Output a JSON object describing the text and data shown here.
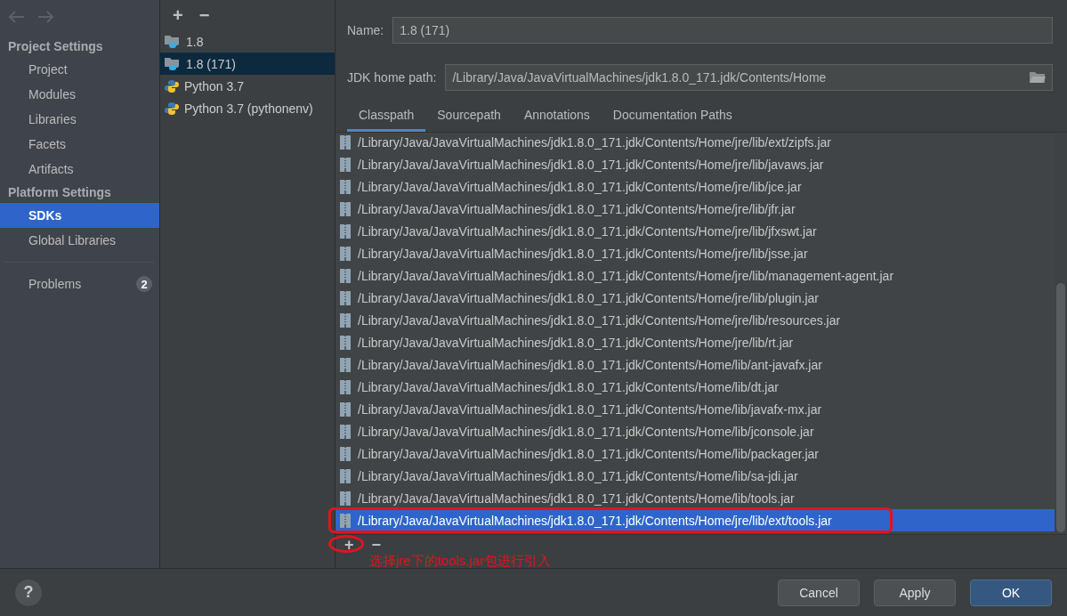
{
  "sidebar": {
    "sections": [
      {
        "title": "Project Settings",
        "items": [
          {
            "label": "Project",
            "selected": false
          },
          {
            "label": "Modules",
            "selected": false
          },
          {
            "label": "Libraries",
            "selected": false
          },
          {
            "label": "Facets",
            "selected": false
          },
          {
            "label": "Artifacts",
            "selected": false
          }
        ]
      },
      {
        "title": "Platform Settings",
        "items": [
          {
            "label": "SDKs",
            "selected": true
          },
          {
            "label": "Global Libraries",
            "selected": false
          }
        ]
      }
    ],
    "problems": {
      "label": "Problems",
      "count": "2"
    }
  },
  "sdk_list": {
    "add": "+",
    "remove": "−",
    "items": [
      {
        "label": "1.8",
        "kind": "jdk",
        "selected": false
      },
      {
        "label": "1.8 (171)",
        "kind": "jdk",
        "selected": true
      },
      {
        "label": "Python 3.7",
        "kind": "python",
        "selected": false
      },
      {
        "label": "Python 3.7 (pythonenv)",
        "kind": "python",
        "selected": false
      }
    ]
  },
  "details": {
    "name_label": "Name:",
    "name_value": "1.8 (171)",
    "home_label": "JDK home path:",
    "home_value": "/Library/Java/JavaVirtualMachines/jdk1.8.0_171.jdk/Contents/Home",
    "tabs": [
      {
        "label": "Classpath",
        "selected": true
      },
      {
        "label": "Sourcepath",
        "selected": false
      },
      {
        "label": "Annotations",
        "selected": false
      },
      {
        "label": "Documentation Paths",
        "selected": false
      }
    ],
    "classpath": [
      {
        "path": "/Library/Java/JavaVirtualMachines/jdk1.8.0_171.jdk/Contents/Home/jre/lib/ext/zipfs.jar",
        "selected": false
      },
      {
        "path": "/Library/Java/JavaVirtualMachines/jdk1.8.0_171.jdk/Contents/Home/jre/lib/javaws.jar",
        "selected": false
      },
      {
        "path": "/Library/Java/JavaVirtualMachines/jdk1.8.0_171.jdk/Contents/Home/jre/lib/jce.jar",
        "selected": false
      },
      {
        "path": "/Library/Java/JavaVirtualMachines/jdk1.8.0_171.jdk/Contents/Home/jre/lib/jfr.jar",
        "selected": false
      },
      {
        "path": "/Library/Java/JavaVirtualMachines/jdk1.8.0_171.jdk/Contents/Home/jre/lib/jfxswt.jar",
        "selected": false
      },
      {
        "path": "/Library/Java/JavaVirtualMachines/jdk1.8.0_171.jdk/Contents/Home/jre/lib/jsse.jar",
        "selected": false
      },
      {
        "path": "/Library/Java/JavaVirtualMachines/jdk1.8.0_171.jdk/Contents/Home/jre/lib/management-agent.jar",
        "selected": false
      },
      {
        "path": "/Library/Java/JavaVirtualMachines/jdk1.8.0_171.jdk/Contents/Home/jre/lib/plugin.jar",
        "selected": false
      },
      {
        "path": "/Library/Java/JavaVirtualMachines/jdk1.8.0_171.jdk/Contents/Home/jre/lib/resources.jar",
        "selected": false
      },
      {
        "path": "/Library/Java/JavaVirtualMachines/jdk1.8.0_171.jdk/Contents/Home/jre/lib/rt.jar",
        "selected": false
      },
      {
        "path": "/Library/Java/JavaVirtualMachines/jdk1.8.0_171.jdk/Contents/Home/lib/ant-javafx.jar",
        "selected": false
      },
      {
        "path": "/Library/Java/JavaVirtualMachines/jdk1.8.0_171.jdk/Contents/Home/lib/dt.jar",
        "selected": false
      },
      {
        "path": "/Library/Java/JavaVirtualMachines/jdk1.8.0_171.jdk/Contents/Home/lib/javafx-mx.jar",
        "selected": false
      },
      {
        "path": "/Library/Java/JavaVirtualMachines/jdk1.8.0_171.jdk/Contents/Home/lib/jconsole.jar",
        "selected": false
      },
      {
        "path": "/Library/Java/JavaVirtualMachines/jdk1.8.0_171.jdk/Contents/Home/lib/packager.jar",
        "selected": false
      },
      {
        "path": "/Library/Java/JavaVirtualMachines/jdk1.8.0_171.jdk/Contents/Home/lib/sa-jdi.jar",
        "selected": false
      },
      {
        "path": "/Library/Java/JavaVirtualMachines/jdk1.8.0_171.jdk/Contents/Home/lib/tools.jar",
        "selected": false
      },
      {
        "path": "/Library/Java/JavaVirtualMachines/jdk1.8.0_171.jdk/Contents/Home/jre/lib/ext/tools.jar",
        "selected": true
      }
    ],
    "add": "+",
    "remove": "−",
    "annotation": "选择jre下的tools.jar包进行引入"
  },
  "footer": {
    "help": "?",
    "buttons": [
      {
        "label": "Cancel",
        "kind": "normal"
      },
      {
        "label": "Apply",
        "kind": "normal"
      },
      {
        "label": "OK",
        "kind": "default"
      }
    ]
  }
}
